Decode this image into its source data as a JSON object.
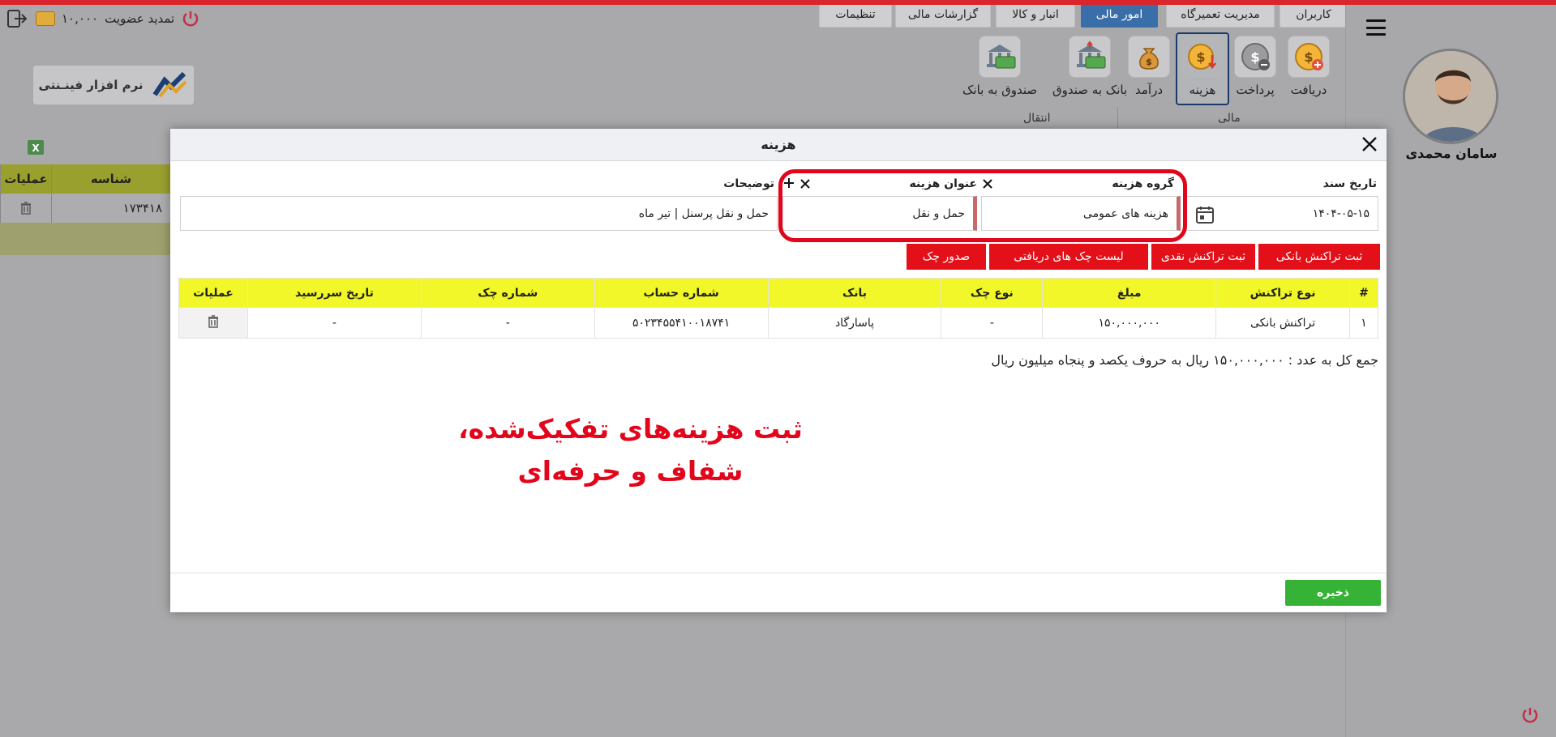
{
  "top": {
    "membership_label": "تمدید عضویت",
    "credit": "۱۰,۰۰۰",
    "tabs": [
      {
        "label": "کاربران"
      },
      {
        "label": "مدیریت تعمیرگاه"
      },
      {
        "label": "امور مالی"
      },
      {
        "label": "انبار و کالا"
      },
      {
        "label": "گزارشات مالی"
      },
      {
        "label": "تنظیمات"
      }
    ],
    "active_tab": "امور مالی"
  },
  "ribbon": {
    "buttons": [
      {
        "label": "دریافت",
        "icon": "coin-plus-icon"
      },
      {
        "label": "پرداخت",
        "icon": "coin-minus-icon"
      },
      {
        "label": "هزینه",
        "icon": "coin-down-icon"
      },
      {
        "label": "درآمد",
        "icon": "money-bag-icon"
      },
      {
        "label": "بانک به صندوق",
        "icon": "bank-to-cash-icon"
      },
      {
        "label": "صندوق به بانک",
        "icon": "cash-to-bank-icon"
      }
    ],
    "selected": "هزینه",
    "groups": {
      "financial": "مالی",
      "transfer": "انتقال"
    }
  },
  "brand": {
    "name": "نرم افزار فینـنتی"
  },
  "background_table": {
    "headers": [
      "شناسه",
      "عملیات"
    ],
    "rows": [
      {
        "id": "۱۷۳۴۱۸"
      }
    ]
  },
  "user": {
    "name": "سامان محمدی"
  },
  "modal": {
    "title": "هزینه",
    "fields": {
      "date_label": "تاریخ سند",
      "date_value": "۱۴۰۴-۰۵-۱۵",
      "group_label": "گروه هزینه",
      "group_value": "هزینه های عمومی",
      "title_label": "عنوان هزینه",
      "title_value": "حمل و نقل",
      "desc_label": "توضیحات",
      "desc_value": "حمل و نقل پرسنل | تیر ماه"
    },
    "buttons": {
      "bank_tx": "ثبت تراکنش بانکی",
      "cash_tx": "ثبت تراکنش نقدی",
      "received_checks": "لیست چک های دریافتی",
      "issue_check": "صدور چک",
      "save": "ذخیره"
    },
    "table": {
      "headers": [
        "#",
        "نوع تراکنش",
        "مبلغ",
        "نوع چک",
        "بانک",
        "شماره حساب",
        "شماره چک",
        "تاریخ سررسید",
        "عملیات"
      ],
      "rows": [
        {
          "idx": "۱",
          "type": "تراکنش بانکی",
          "amount": "۱۵۰,۰۰۰,۰۰۰",
          "check_type": "-",
          "bank": "پاسارگاد",
          "account": "۵۰۲۳۴۵۵۴۱۰۰۱۸۷۴۱",
          "check_no": "-",
          "due": "-"
        }
      ]
    },
    "total": "جمع کل به عدد : ۱۵۰,۰۰۰,۰۰۰ ریال به حروف یکصد و پنجاه میلیون ریال",
    "promo": {
      "line1": "ثبت هزینه‌های تفکیک‌شده،",
      "line2": "شفاف و حرفه‌ای"
    }
  },
  "colors": {
    "accent_red": "#e30f19",
    "ring_red": "#e1061b",
    "header_yellow": "#f1f728",
    "save_green": "#36b337",
    "active_tab_blue": "#3a6ea8"
  }
}
